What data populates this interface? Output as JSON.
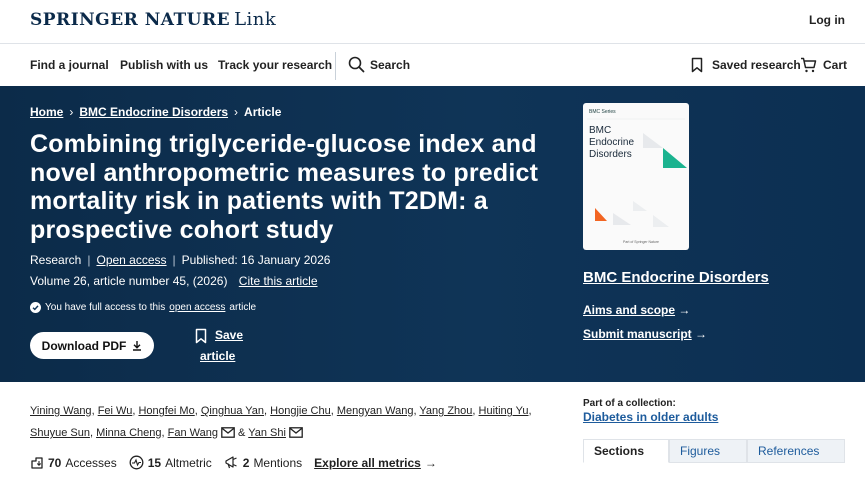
{
  "brand": {
    "logo_primary": "SPRINGER NATURE",
    "logo_secondary": "Link",
    "login": "Log in"
  },
  "nav": {
    "find_journal": "Find a journal",
    "publish": "Publish with us",
    "track": "Track your research",
    "search": "Search",
    "saved": "Saved research",
    "cart": "Cart"
  },
  "breadcrumb": {
    "home": "Home",
    "journal": "BMC Endocrine Disorders",
    "current": "Article"
  },
  "article": {
    "title": "Combining triglyceride-glucose index and novel anthropometric measures to predict mortality risk in patients with T2DM: a prospective cohort study",
    "type": "Research",
    "open_access": "Open access",
    "published": "Published: 16 January 2026",
    "volume": "Volume 26, article number 45, (2026)",
    "cite": "Cite this article",
    "access_prefix": "You have full access to this",
    "access_link": "open access",
    "access_suffix": "article",
    "download": "Download PDF",
    "save_line1": "Save",
    "save_line2": "article"
  },
  "journal": {
    "cover_series": "BMC Series",
    "cover_title": "BMC Endocrine Disorders",
    "cover_fine": "Part of Springer Nature",
    "name": "BMC Endocrine Disorders",
    "aims": "Aims and scope",
    "submit": "Submit manuscript"
  },
  "authors": [
    "Yining Wang",
    "Fei Wu",
    "Hongfei Mo",
    "Qinghua Yan",
    "Hongjie Chu",
    "Mengyan Wang",
    "Yang Zhou",
    "Huiting Yu",
    "Shuyue Sun",
    "Minna Cheng",
    "Fan Wang",
    "Yan Shi"
  ],
  "authors_sep": "&",
  "metrics": {
    "accesses_count": "70",
    "accesses_label": "Accesses",
    "altmetric_count": "15",
    "altmetric_label": "Altmetric",
    "mentions_count": "2",
    "mentions_label": "Mentions",
    "explore": "Explore all metrics"
  },
  "collection": {
    "label": "Part of a collection:",
    "name": "Diabetes in older adults"
  },
  "tabs": [
    "Sections",
    "Figures",
    "References"
  ],
  "colors": {
    "hero_bg": "#0f3457",
    "cover_teal": "#1bb38f",
    "cover_orange": "#f26522",
    "link_blue": "#1d5b9c"
  }
}
